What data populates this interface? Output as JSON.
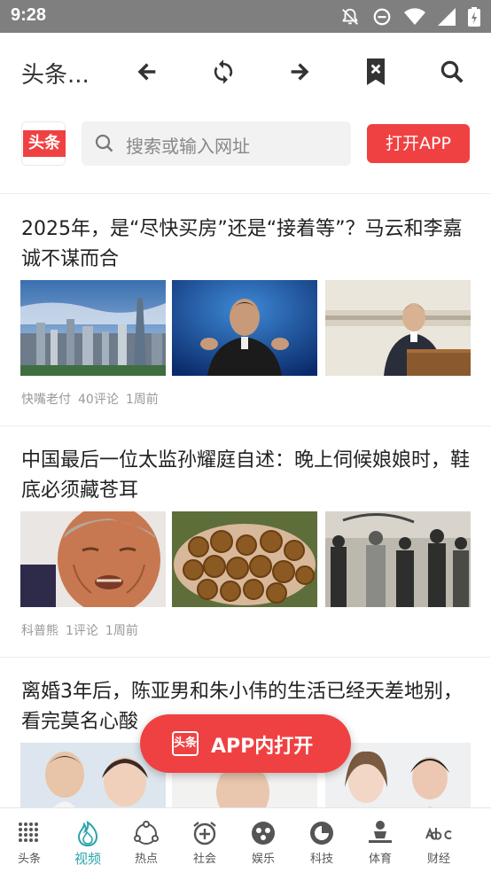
{
  "status_bar": {
    "time": "9:28"
  },
  "toolbar": {
    "title": "头条..."
  },
  "header": {
    "logo_text": "头条",
    "search_placeholder": "搜索或输入网址",
    "open_app_label": "打开APP"
  },
  "articles": [
    {
      "title": "2025年，是“尽快买房”还是“接着等”？马云和李嘉诚不谋而合",
      "source": "快嘴老付",
      "comments": "40评论",
      "time": "1周前"
    },
    {
      "title": "中国最后一位太监孙耀庭自述：晚上伺候娘娘时，鞋底必须藏苍耳",
      "source": "科普熊",
      "comments": "1评论",
      "time": "1周前"
    },
    {
      "title": "离婚3年后，陈亚男和朱小伟的生活已经天差地别，看完莫名心酸",
      "source": "",
      "comments": "",
      "time": ""
    }
  ],
  "float_button": {
    "logo_text": "头条",
    "label": "APP内打开"
  },
  "bottom_nav": {
    "items": [
      {
        "label": "头条",
        "icon": "grid-dots-icon"
      },
      {
        "label": "视频",
        "icon": "flame-icon"
      },
      {
        "label": "热点",
        "icon": "hotspot-circle-icon"
      },
      {
        "label": "社会",
        "icon": "alarm-plus-icon"
      },
      {
        "label": "娱乐",
        "icon": "ball-icon"
      },
      {
        "label": "科技",
        "icon": "tech-circle-icon"
      },
      {
        "label": "体育",
        "icon": "athlete-icon"
      },
      {
        "label": "财经",
        "icon": "abc-icon"
      }
    ],
    "active_index": 1,
    "active_color": "#2aa5a8"
  },
  "colors": {
    "brand_red": "#f04142",
    "status_bar": "#7f7f7f"
  }
}
